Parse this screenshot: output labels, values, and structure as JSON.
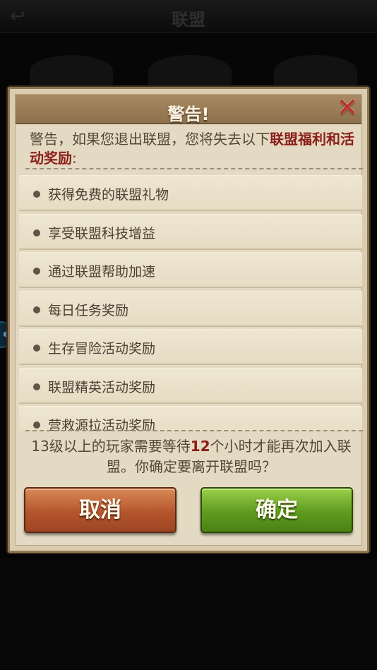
{
  "background": {
    "title": "联盟"
  },
  "dialog": {
    "title": "警告!",
    "warning_prefix": "警告，如果您退出联盟，您将失去以下",
    "warning_highlight": "联盟福利和活动奖励",
    "warning_suffix": ":",
    "benefits": [
      "获得免费的联盟礼物",
      "享受联盟科技增益",
      "通过联盟帮助加速",
      "每日任务奖励",
      "生存冒险活动奖励",
      "联盟精英活动奖励",
      "营救源拉活动奖励"
    ],
    "notice_prefix": "13级以上的玩家需要等待",
    "notice_hours": "12",
    "notice_suffix": "个小时才能再次加入联盟。你确定要离开联盟吗？",
    "cancel_label": "取消",
    "confirm_label": "确定"
  },
  "icons": {
    "close": "close-x-icon",
    "back": "back-arrow-icon",
    "bullet": "bullet-dot-icon"
  },
  "colors": {
    "highlight": "#8a1f17",
    "cancel_button": "#b5552e",
    "confirm_button": "#5f9b1f",
    "close_icon": "#b9332b"
  }
}
